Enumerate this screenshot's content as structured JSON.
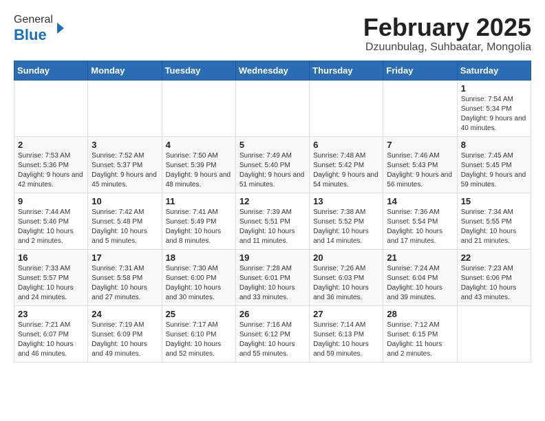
{
  "header": {
    "logo_general": "General",
    "logo_blue": "Blue",
    "month_title": "February 2025",
    "location": "Dzuunbulag, Suhbaatar, Mongolia"
  },
  "weekdays": [
    "Sunday",
    "Monday",
    "Tuesday",
    "Wednesday",
    "Thursday",
    "Friday",
    "Saturday"
  ],
  "weeks": [
    [
      {
        "day": "",
        "info": ""
      },
      {
        "day": "",
        "info": ""
      },
      {
        "day": "",
        "info": ""
      },
      {
        "day": "",
        "info": ""
      },
      {
        "day": "",
        "info": ""
      },
      {
        "day": "",
        "info": ""
      },
      {
        "day": "1",
        "info": "Sunrise: 7:54 AM\nSunset: 5:34 PM\nDaylight: 9 hours and 40 minutes."
      }
    ],
    [
      {
        "day": "2",
        "info": "Sunrise: 7:53 AM\nSunset: 5:36 PM\nDaylight: 9 hours and 42 minutes."
      },
      {
        "day": "3",
        "info": "Sunrise: 7:52 AM\nSunset: 5:37 PM\nDaylight: 9 hours and 45 minutes."
      },
      {
        "day": "4",
        "info": "Sunrise: 7:50 AM\nSunset: 5:39 PM\nDaylight: 9 hours and 48 minutes."
      },
      {
        "day": "5",
        "info": "Sunrise: 7:49 AM\nSunset: 5:40 PM\nDaylight: 9 hours and 51 minutes."
      },
      {
        "day": "6",
        "info": "Sunrise: 7:48 AM\nSunset: 5:42 PM\nDaylight: 9 hours and 54 minutes."
      },
      {
        "day": "7",
        "info": "Sunrise: 7:46 AM\nSunset: 5:43 PM\nDaylight: 9 hours and 56 minutes."
      },
      {
        "day": "8",
        "info": "Sunrise: 7:45 AM\nSunset: 5:45 PM\nDaylight: 9 hours and 59 minutes."
      }
    ],
    [
      {
        "day": "9",
        "info": "Sunrise: 7:44 AM\nSunset: 5:46 PM\nDaylight: 10 hours and 2 minutes."
      },
      {
        "day": "10",
        "info": "Sunrise: 7:42 AM\nSunset: 5:48 PM\nDaylight: 10 hours and 5 minutes."
      },
      {
        "day": "11",
        "info": "Sunrise: 7:41 AM\nSunset: 5:49 PM\nDaylight: 10 hours and 8 minutes."
      },
      {
        "day": "12",
        "info": "Sunrise: 7:39 AM\nSunset: 5:51 PM\nDaylight: 10 hours and 11 minutes."
      },
      {
        "day": "13",
        "info": "Sunrise: 7:38 AM\nSunset: 5:52 PM\nDaylight: 10 hours and 14 minutes."
      },
      {
        "day": "14",
        "info": "Sunrise: 7:36 AM\nSunset: 5:54 PM\nDaylight: 10 hours and 17 minutes."
      },
      {
        "day": "15",
        "info": "Sunrise: 7:34 AM\nSunset: 5:55 PM\nDaylight: 10 hours and 21 minutes."
      }
    ],
    [
      {
        "day": "16",
        "info": "Sunrise: 7:33 AM\nSunset: 5:57 PM\nDaylight: 10 hours and 24 minutes."
      },
      {
        "day": "17",
        "info": "Sunrise: 7:31 AM\nSunset: 5:58 PM\nDaylight: 10 hours and 27 minutes."
      },
      {
        "day": "18",
        "info": "Sunrise: 7:30 AM\nSunset: 6:00 PM\nDaylight: 10 hours and 30 minutes."
      },
      {
        "day": "19",
        "info": "Sunrise: 7:28 AM\nSunset: 6:01 PM\nDaylight: 10 hours and 33 minutes."
      },
      {
        "day": "20",
        "info": "Sunrise: 7:26 AM\nSunset: 6:03 PM\nDaylight: 10 hours and 36 minutes."
      },
      {
        "day": "21",
        "info": "Sunrise: 7:24 AM\nSunset: 6:04 PM\nDaylight: 10 hours and 39 minutes."
      },
      {
        "day": "22",
        "info": "Sunrise: 7:23 AM\nSunset: 6:06 PM\nDaylight: 10 hours and 43 minutes."
      }
    ],
    [
      {
        "day": "23",
        "info": "Sunrise: 7:21 AM\nSunset: 6:07 PM\nDaylight: 10 hours and 46 minutes."
      },
      {
        "day": "24",
        "info": "Sunrise: 7:19 AM\nSunset: 6:09 PM\nDaylight: 10 hours and 49 minutes."
      },
      {
        "day": "25",
        "info": "Sunrise: 7:17 AM\nSunset: 6:10 PM\nDaylight: 10 hours and 52 minutes."
      },
      {
        "day": "26",
        "info": "Sunrise: 7:16 AM\nSunset: 6:12 PM\nDaylight: 10 hours and 55 minutes."
      },
      {
        "day": "27",
        "info": "Sunrise: 7:14 AM\nSunset: 6:13 PM\nDaylight: 10 hours and 59 minutes."
      },
      {
        "day": "28",
        "info": "Sunrise: 7:12 AM\nSunset: 6:15 PM\nDaylight: 11 hours and 2 minutes."
      },
      {
        "day": "",
        "info": ""
      }
    ]
  ]
}
